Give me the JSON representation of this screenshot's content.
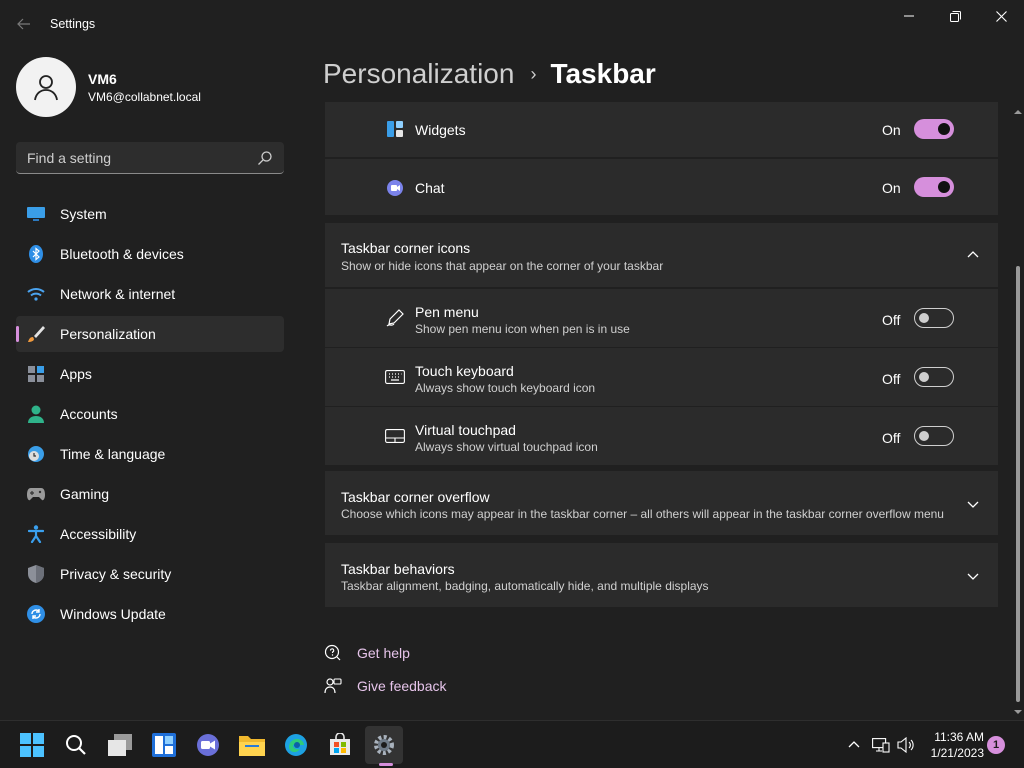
{
  "window": {
    "title": "Settings",
    "minimize_label": "",
    "controls": [
      "minimize",
      "maximize",
      "close"
    ]
  },
  "profile": {
    "name": "VM6",
    "email": "VM6@collabnet.local"
  },
  "search": {
    "placeholder": "Find a setting"
  },
  "sidebar": {
    "items": [
      {
        "label": "System",
        "icon": "monitor-icon"
      },
      {
        "label": "Bluetooth & devices",
        "icon": "bluetooth-icon"
      },
      {
        "label": "Network & internet",
        "icon": "wifi-icon"
      },
      {
        "label": "Personalization",
        "icon": "brush-icon",
        "active": true
      },
      {
        "label": "Apps",
        "icon": "apps-icon"
      },
      {
        "label": "Accounts",
        "icon": "person-icon"
      },
      {
        "label": "Time & language",
        "icon": "clock-globe-icon"
      },
      {
        "label": "Gaming",
        "icon": "gamepad-icon"
      },
      {
        "label": "Accessibility",
        "icon": "accessibility-icon"
      },
      {
        "label": "Privacy & security",
        "icon": "shield-icon"
      },
      {
        "label": "Windows Update",
        "icon": "sync-icon"
      }
    ]
  },
  "breadcrumb": {
    "parent": "Personalization",
    "separator": "›",
    "current": "Taskbar"
  },
  "taskbar_items": {
    "widgets": {
      "label": "Widgets",
      "state": "On",
      "on": true
    },
    "chat": {
      "label": "Chat",
      "state": "On",
      "on": true
    }
  },
  "corner_icons": {
    "title": "Taskbar corner icons",
    "description": "Show or hide icons that appear on the corner of your taskbar",
    "expanded": true,
    "items": [
      {
        "label": "Pen menu",
        "description": "Show pen menu icon when pen is in use",
        "state": "Off",
        "on": false,
        "icon": "pen-icon"
      },
      {
        "label": "Touch keyboard",
        "description": "Always show touch keyboard icon",
        "state": "Off",
        "on": false,
        "icon": "keyboard-icon"
      },
      {
        "label": "Virtual touchpad",
        "description": "Always show virtual touchpad icon",
        "state": "Off",
        "on": false,
        "icon": "touchpad-icon"
      }
    ]
  },
  "corner_overflow": {
    "title": "Taskbar corner overflow",
    "description": "Choose which icons may appear in the taskbar corner – all others will appear in the taskbar corner overflow menu"
  },
  "behaviors": {
    "title": "Taskbar behaviors",
    "description": "Taskbar alignment, badging, automatically hide, and multiple displays"
  },
  "links": {
    "help": "Get help",
    "feedback": "Give feedback"
  },
  "taskbar": {
    "apps": [
      "start-icon",
      "search-icon",
      "task-view-icon",
      "widgets-icon",
      "chat-icon",
      "file-explorer-icon",
      "edge-icon",
      "store-icon",
      "settings-icon"
    ],
    "time": "11:36 AM",
    "date": "1/21/2023",
    "notification_count": "1"
  },
  "colors": {
    "accent": "#d68fdc",
    "background": "#202020",
    "card": "#2b2b2b"
  }
}
